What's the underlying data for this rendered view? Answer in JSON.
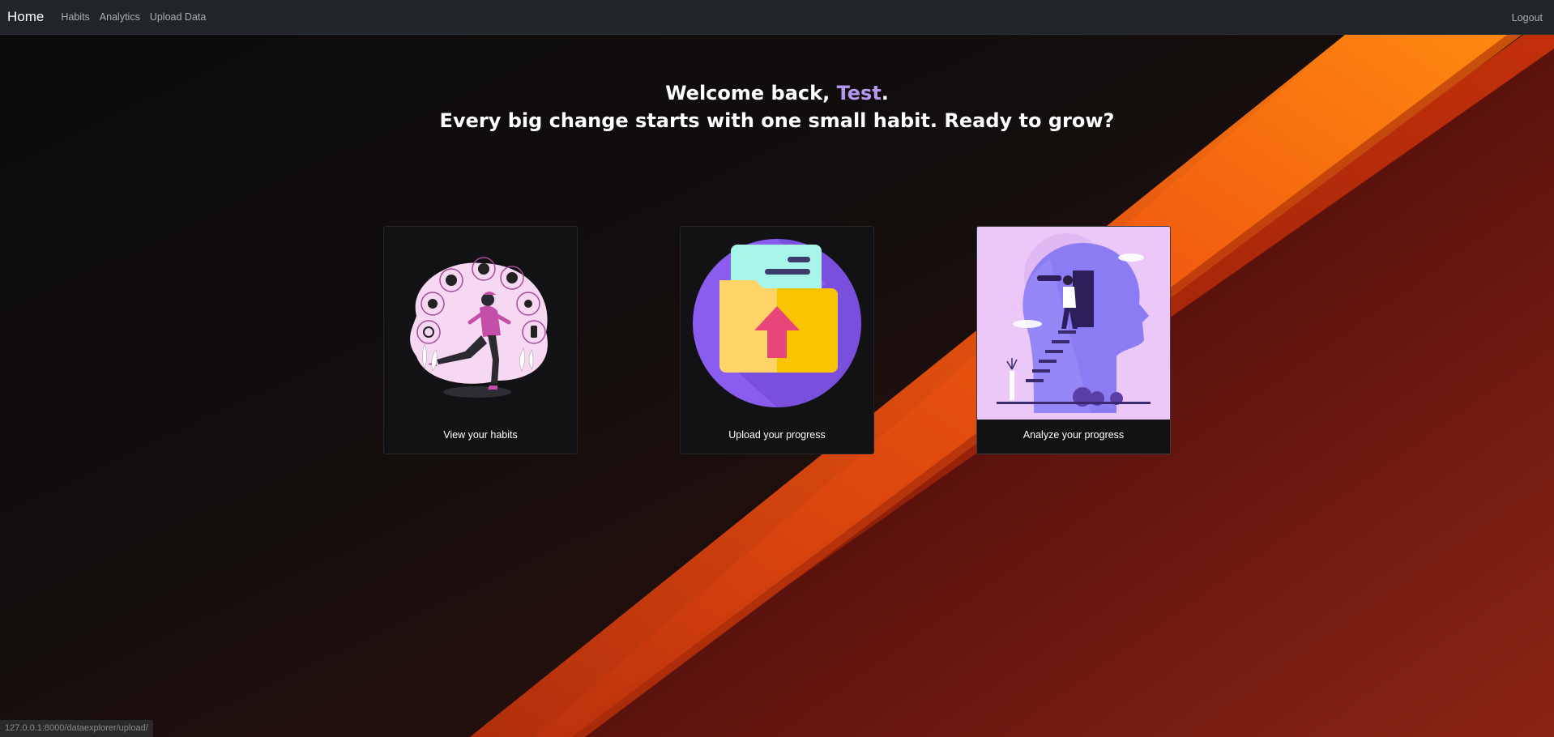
{
  "navbar": {
    "brand": "Home",
    "links": [
      "Habits",
      "Analytics",
      "Upload Data"
    ],
    "logout": "Logout"
  },
  "hero": {
    "greeting_prefix": "Welcome back, ",
    "username": "Test",
    "greeting_suffix": ".",
    "tagline": "Every big change starts with one small habit. Ready to grow?"
  },
  "cards": [
    {
      "caption": "View your habits",
      "illustration": "woman-running-icon"
    },
    {
      "caption": "Upload your progress",
      "illustration": "folder-upload-icon"
    },
    {
      "caption": "Analyze your progress",
      "illustration": "mind-staircase-icon"
    }
  ],
  "statusbar": {
    "url": "127.0.0.1:8000/dataexplorer/upload/"
  },
  "colors": {
    "navbar_bg": "#212529",
    "accent_name": "#b497f0",
    "stripe_orange": "#f06a10",
    "background_dark": "#0e0e0f"
  }
}
